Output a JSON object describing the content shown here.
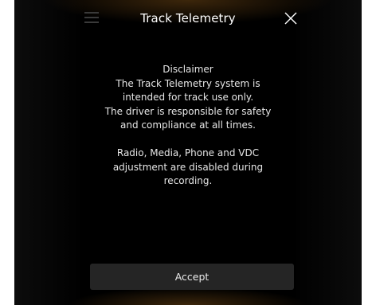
{
  "header": {
    "title": "Track Telemetry",
    "menu_icon": "hamburger-menu-icon",
    "close_icon": "close-x-icon"
  },
  "disclaimer": {
    "heading": "Disclaimer",
    "lines": [
      "The Track Telemetry system is",
      "intended for track use only.",
      "The driver is responsible for safety",
      "and compliance at all times."
    ],
    "note_lines": [
      "Radio, Media,  Phone and VDC",
      "adjustment are disabled during",
      "recording."
    ]
  },
  "actions": {
    "accept_label": "Accept"
  },
  "colors": {
    "background": "#000000",
    "glow": "#6e4614",
    "button": "#252525",
    "text": "#ffffff"
  }
}
